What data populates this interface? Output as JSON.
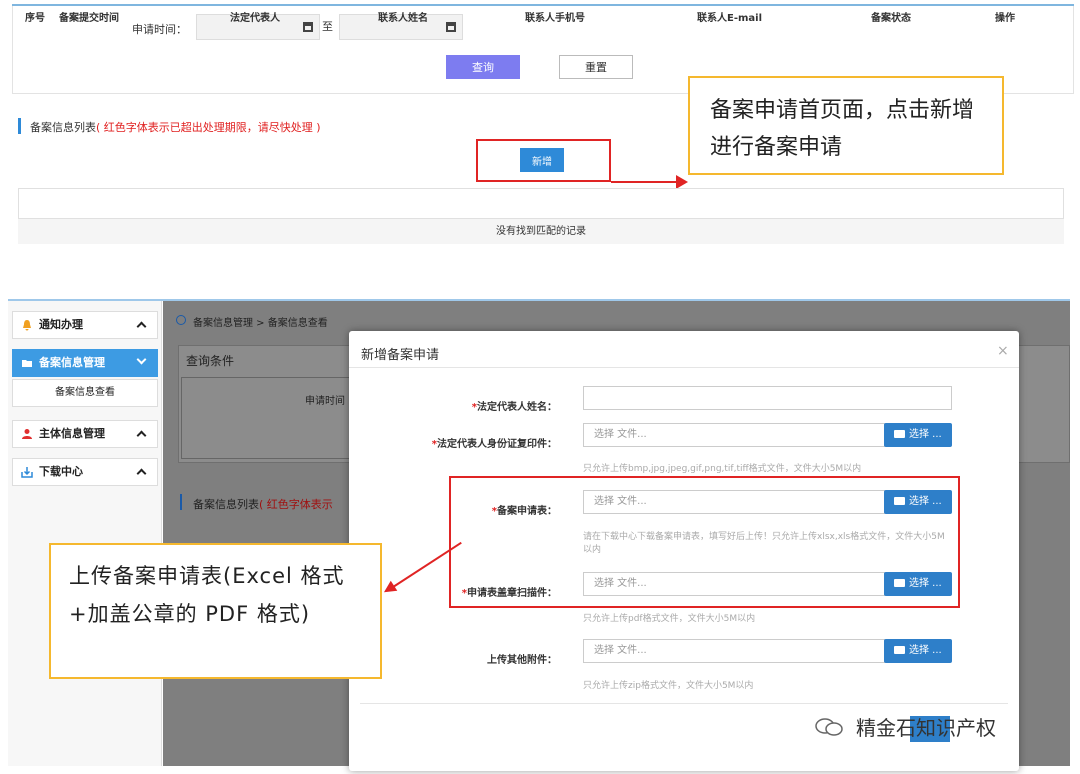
{
  "top": {
    "date_label": "申请时间：",
    "date_to": "至",
    "query_button": "查询",
    "reset_button": "重置",
    "list_title": "备案信息列表",
    "list_note": "( 红色字体表示已超出处理期限，请尽快处理 )",
    "add_button": "新增",
    "table": {
      "columns": [
        "序号",
        "备案提交时间",
        "法定代表人",
        "联系人姓名",
        "联系人手机号",
        "联系人E-mail",
        "备案状态",
        "操作"
      ],
      "empty_text": "没有找到匹配的记录"
    },
    "callout": "备案申请首页面，点击新增进行备案申请"
  },
  "bottom": {
    "sidebar": {
      "items": [
        {
          "label": "通知办理"
        },
        {
          "label": "备案信息管理"
        },
        {
          "label": "主体信息管理"
        },
        {
          "label": "下载中心"
        }
      ],
      "sub_item": "备案信息查看"
    },
    "breadcrumb": "备案信息管理 > 备案信息查看",
    "query_panel_title": "查询条件",
    "ghost_date_label": "申请时间",
    "ghost_list_title": "备案信息列表",
    "ghost_list_note": "( 红色字体表示",
    "modal": {
      "title": "新增备案申请",
      "close": "×",
      "choose_label": "选择 ...",
      "file_placeholder": "选择 文件...",
      "fields": [
        {
          "label": "法定代表人姓名：",
          "required": "*"
        },
        {
          "label": "法定代表人身份证复印件：",
          "required": "*",
          "hint": "只允许上传bmp,jpg,jpeg,gif,png,tif,tiff格式文件，文件大小5M以内"
        },
        {
          "label": "备案申请表：",
          "required": "*",
          "hint": "请在下载中心下载备案申请表，填写好后上传！只允许上传xlsx,xls格式文件，文件大小5M以内"
        },
        {
          "label": "申请表盖章扫描件：",
          "required": "*",
          "hint": "只允许上传pdf格式文件，文件大小5M以内"
        },
        {
          "label": "上传其他附件：",
          "required": "",
          "hint": "只允许上传zip格式文件，文件大小5M以内"
        }
      ]
    },
    "callout": "上传备案申请表(Excel 格式+加盖公章的 PDF 格式)",
    "watermark": "精金石知识产权"
  },
  "colors": {
    "accent_blue": "#2e8ad8",
    "query_purple": "#7d7cf0",
    "annotation_red": "#e02424",
    "callout_border": "#f5b82e",
    "note_red": "#e02020"
  }
}
